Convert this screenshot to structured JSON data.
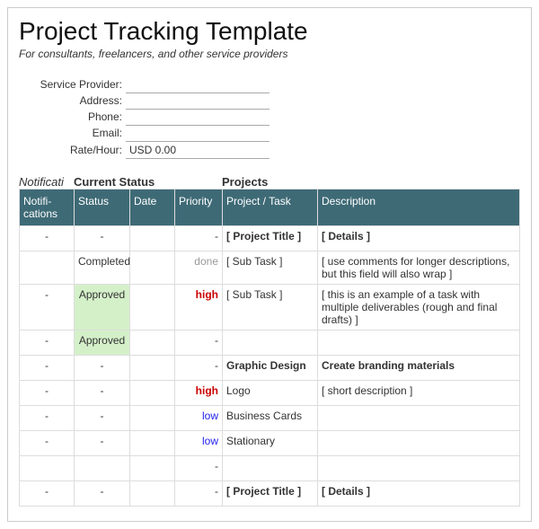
{
  "header": {
    "title": "Project Tracking Template",
    "subtitle": "For consultants, freelancers, and other service providers"
  },
  "info": {
    "labels": {
      "provider": "Service Provider:",
      "address": "Address:",
      "phone": "Phone:",
      "email": "Email:",
      "rate": "Rate/Hour:"
    },
    "values": {
      "provider": "",
      "address": "",
      "phone": "",
      "email": "",
      "rate": "USD 0.00"
    }
  },
  "sections": {
    "notif": "Notificati",
    "status": "Current Status",
    "projects": "Projects"
  },
  "columns": {
    "notif": "Notifi-cations",
    "status": "Status",
    "date": "Date",
    "priority": "Priority",
    "task": "Project / Task",
    "desc": "Description"
  },
  "rows": [
    {
      "type": "section",
      "notif": "-",
      "status": "-",
      "date": "",
      "priority": "-",
      "task": "[ Project Title ]",
      "desc": "[ Details ]"
    },
    {
      "type": "data",
      "notif": "",
      "status": "Completed",
      "date": "",
      "priority": "done",
      "priClass": "pri-done",
      "task": "[ Sub Task ]",
      "desc": "[ use comments for longer descriptions, but this field will also wrap ]"
    },
    {
      "type": "data",
      "notif": "-",
      "status": "Approved",
      "statusClass": "status-approved",
      "date": "",
      "priority": "high",
      "priClass": "pri-high",
      "task": "[ Sub Task ]",
      "desc": "[ this is an example of a task with multiple deliverables (rough and final drafts) ]"
    },
    {
      "type": "data",
      "notif": "-",
      "status": "Approved",
      "statusClass": "status-approved",
      "date": "",
      "priority": "-",
      "task": "",
      "desc": ""
    },
    {
      "type": "section",
      "notif": "-",
      "status": "-",
      "date": "",
      "priority": "-",
      "task": "Graphic Design",
      "desc": "Create branding materials"
    },
    {
      "type": "data",
      "notif": "-",
      "status": "-",
      "date": "",
      "priority": "high",
      "priClass": "pri-high",
      "task": "Logo",
      "desc": "[ short description ]"
    },
    {
      "type": "data",
      "notif": "-",
      "status": "-",
      "date": "",
      "priority": "low",
      "priClass": "pri-low",
      "task": "Business Cards",
      "desc": ""
    },
    {
      "type": "data",
      "notif": "-",
      "status": "-",
      "date": "",
      "priority": "low",
      "priClass": "pri-low",
      "task": "Stationary",
      "desc": ""
    },
    {
      "type": "data",
      "notif": "",
      "status": "",
      "date": "",
      "priority": "-",
      "task": "",
      "desc": ""
    },
    {
      "type": "section",
      "notif": "-",
      "status": "-",
      "date": "",
      "priority": "-",
      "task": "[ Project Title ]",
      "desc": "[ Details ]"
    }
  ]
}
